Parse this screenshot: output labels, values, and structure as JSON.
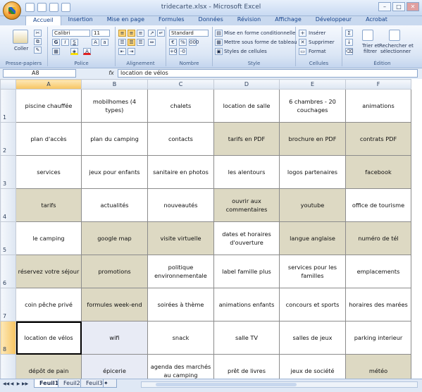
{
  "window": {
    "title": "tridecarte.xlsx - Microsoft Excel"
  },
  "ribbon": {
    "tabs": [
      "Accueil",
      "Insertion",
      "Mise en page",
      "Formules",
      "Données",
      "Révision",
      "Affichage",
      "Développeur",
      "Acrobat"
    ],
    "active_tab": "Accueil",
    "clipboard": {
      "paste_label": "Coller",
      "group_label": "Presse-papiers"
    },
    "font": {
      "name": "Calibri",
      "size": "11",
      "group_label": "Police"
    },
    "alignment": {
      "group_label": "Alignement"
    },
    "number": {
      "format": "Standard",
      "group_label": "Nombre"
    },
    "style": {
      "conditional": "Mise en forme conditionnelle",
      "table": "Mettre sous forme de tableau",
      "cell_styles": "Styles de cellules",
      "group_label": "Style"
    },
    "cells": {
      "insert": "Insérer",
      "delete": "Supprimer",
      "format": "Format",
      "group_label": "Cellules"
    },
    "editing": {
      "sort_filter_line1": "Trier et",
      "sort_filter_line2": "filtrer",
      "find_select_line1": "Rechercher et",
      "find_select_line2": "sélectionner",
      "group_label": "Édition"
    }
  },
  "formula_bar": {
    "name_box": "A8",
    "fx": "fx",
    "content": "location de vélos"
  },
  "columns": [
    "A",
    "B",
    "C",
    "D",
    "E",
    "F"
  ],
  "rows": [
    {
      "n": "1",
      "cells": [
        "piscine chauffée",
        "mobilhomes (4 types)",
        "chalets",
        "location de salle",
        "6 chambres - 20 couchages",
        "animations"
      ]
    },
    {
      "n": "2",
      "cells": [
        "plan d'accès",
        "plan du camping",
        "contacts",
        "tarifs en PDF",
        "brochure en PDF",
        "contrats PDF"
      ]
    },
    {
      "n": "3",
      "cells": [
        "services",
        "jeux pour enfants",
        "sanitaire en photos",
        "les alentours",
        "logos partenaires",
        "facebook"
      ]
    },
    {
      "n": "4",
      "cells": [
        "tarifs",
        "actualités",
        "nouveautés",
        "ouvrir aux commentaires",
        "youtube",
        "office de tourisme"
      ]
    },
    {
      "n": "5",
      "cells": [
        "le camping",
        "google map",
        "visite virtuelle",
        "dates et horaires d'ouverture",
        "langue anglaise",
        "numéro de tél"
      ]
    },
    {
      "n": "6",
      "cells": [
        "réservez votre séjour",
        "promotions",
        "politique environnementale",
        "label famille plus",
        "services pour les familles",
        "emplacements"
      ]
    },
    {
      "n": "7",
      "cells": [
        "coin pêche privé",
        "formules week-end",
        "soirées à thème",
        "animations enfants",
        "concours et sports",
        "horaires des marées"
      ]
    },
    {
      "n": "8",
      "cells": [
        "location de vélos",
        "wifi",
        "snack",
        "salle TV",
        "salles de jeux",
        "parking interieur"
      ]
    },
    {
      "n": "9",
      "cells": [
        "dépôt de pain",
        "épicerie",
        "agenda des marchés au camping",
        "prêt de livres",
        "jeux de société",
        "météo"
      ]
    }
  ],
  "sheets": [
    "Feuil1",
    "Feuil2",
    "Feuil3"
  ],
  "active_sheet": "Feuil1"
}
